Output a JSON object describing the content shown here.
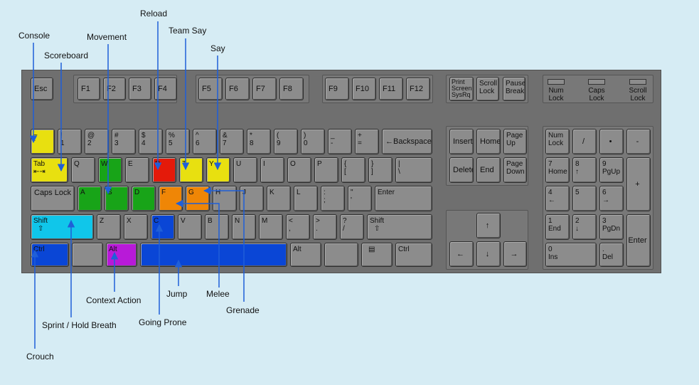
{
  "labels": {
    "console": "Console",
    "scoreboard": "Scoreboard",
    "movement": "Movement",
    "reload": "Reload",
    "team_say": "Team Say",
    "say": "Say",
    "crouch": "Crouch",
    "sprint": "Sprint / Hold Breath",
    "context_action": "Context Action",
    "going_prone": "Going Prone",
    "jump": "Jump",
    "melee": "Melee",
    "grenade": "Grenade"
  },
  "keys": {
    "esc": "Esc",
    "f1": "F1",
    "f2": "F2",
    "f3": "F3",
    "f4": "F4",
    "f5": "F5",
    "f6": "F6",
    "f7": "F7",
    "f8": "F8",
    "f9": "F9",
    "f10": "F10",
    "f11": "F11",
    "f12": "F12",
    "print": [
      "Print",
      "Screen",
      "SysRq"
    ],
    "scroll": [
      "Scroll",
      "Lock"
    ],
    "pause": [
      "Pause",
      "Break"
    ],
    "tilde": [
      "~",
      "`"
    ],
    "n1": [
      "!",
      "1"
    ],
    "n2": [
      "@",
      "2"
    ],
    "n3": [
      "#",
      "3"
    ],
    "n4": [
      "$",
      "4"
    ],
    "n5": [
      "%",
      "5"
    ],
    "n6": [
      "^",
      "6"
    ],
    "n7": [
      "&",
      "7"
    ],
    "n8": [
      "*",
      "8"
    ],
    "n9": [
      "(",
      "9"
    ],
    "n0": [
      ")",
      "0"
    ],
    "minus": [
      "_",
      "-"
    ],
    "equals": [
      "+",
      "="
    ],
    "backspace": "←Backspace",
    "tab": "Tab",
    "q": "Q",
    "w": "W",
    "e": "E",
    "r": "R",
    "t": "T",
    "y": "Y",
    "u": "U",
    "i": "I",
    "o": "O",
    "p": "P",
    "lbrace": [
      "{",
      "["
    ],
    "rbrace": [
      "}",
      "]"
    ],
    "pipe": [
      "|",
      "\\"
    ],
    "caps": "Caps Lock",
    "a": "A",
    "s": "S",
    "d": "D",
    "f": "F",
    "g": "G",
    "h": "H",
    "j": "J",
    "k": "K",
    "l": "L",
    "semi": [
      ":",
      ";"
    ],
    "quote": [
      "\"",
      "'"
    ],
    "enter": "Enter",
    "lshift": "Shift",
    "rshift": "Shift",
    "z": "Z",
    "x": "X",
    "c": "C",
    "v": "V",
    "b": "B",
    "n": "N",
    "m": "M",
    "comma": [
      "<",
      ","
    ],
    "period": [
      ">",
      "."
    ],
    "slash": [
      "?",
      "/"
    ],
    "lctrl": "Ctrl",
    "lalt": "Alt",
    "ralt": "Alt",
    "rctrl": "Ctrl",
    "insert": "Insert",
    "home": "Home",
    "pageup": [
      "Page",
      "Up"
    ],
    "delete": "Delete",
    "end": "End",
    "pagedown": [
      "Page",
      "Down"
    ],
    "up": "↑",
    "left": "←",
    "down": "↓",
    "right": "→",
    "numlock": [
      "Num",
      "Lock"
    ],
    "kp_div": "/",
    "kp_mul": "•",
    "kp_sub": "-",
    "kp7": [
      "7",
      "Home"
    ],
    "kp8": [
      "8",
      "↑"
    ],
    "kp9": [
      "9",
      "PgUp"
    ],
    "kp_add": "+",
    "kp4": [
      "4",
      "←"
    ],
    "kp5": "5",
    "kp6": [
      "6",
      "→"
    ],
    "kp1": [
      "1",
      "End"
    ],
    "kp2": [
      "2",
      "↓"
    ],
    "kp3": [
      "3",
      "PgDn"
    ],
    "kp_enter": "Enter",
    "kp0": [
      "0",
      "Ins"
    ],
    "kp_dot": [
      ".",
      "Del"
    ]
  },
  "indicators": [
    [
      "Num",
      "Lock"
    ],
    [
      "Caps",
      "Lock"
    ],
    [
      "Scroll",
      "Lock"
    ]
  ],
  "colors": {
    "background": "#d6ecf4",
    "keyboard": "#6f6f6f",
    "key": "#8c8c8c",
    "console_scoreboard_say": "#e8e010",
    "movement": "#18a418",
    "reload": "#e41a0a",
    "melee_grenade": "#ef8606",
    "sprint": "#10c6ea",
    "crouch_prone_jump": "#0a46d6",
    "context_action": "#b81ad8",
    "arrow": "#1f5fd8"
  }
}
